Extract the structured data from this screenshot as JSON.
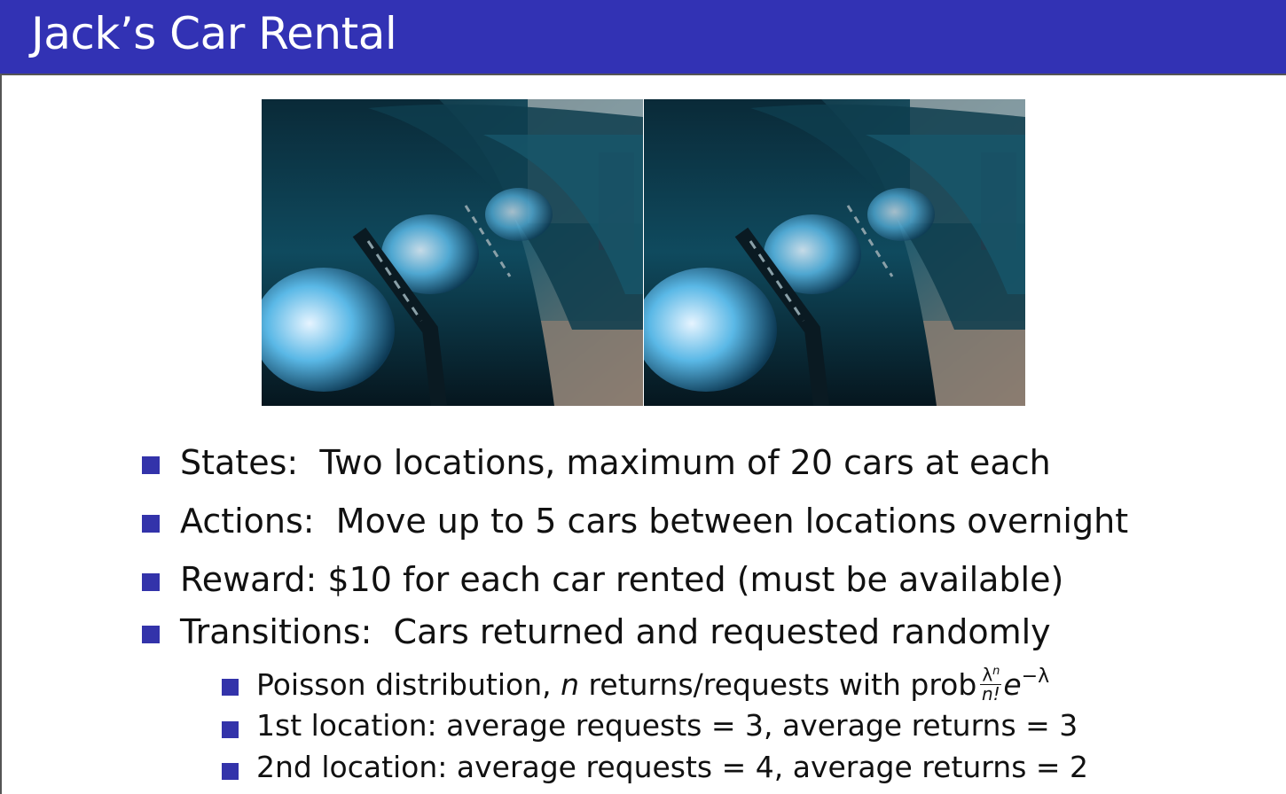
{
  "slide": {
    "title": "Jack’s Car Rental"
  },
  "images": [
    {
      "name": "cars-photo-left",
      "description": "row of parked cars"
    },
    {
      "name": "cars-photo-right",
      "description": "row of parked cars"
    }
  ],
  "bullets": [
    {
      "label": "States:",
      "text": "Two locations, maximum of 20 cars at each"
    },
    {
      "label": "Actions:",
      "text": "Move up to 5 cars between locations overnight"
    },
    {
      "label": "Reward:",
      "text": "$10 for each car rented (must be available)"
    },
    {
      "label": "Transitions:",
      "text": "Cars returned and requested randomly"
    }
  ],
  "sub_bullets": {
    "poisson": {
      "before": "Poisson distribution,",
      "var": "n",
      "after": "returns/requests with prob",
      "frac_num": "λ",
      "frac_num_sup": "n",
      "frac_den": "n!",
      "exp_base": "e",
      "exp_power": "−λ"
    },
    "loc1": "1st location: average requests = 3, average returns = 3",
    "loc2": "2nd location: average requests = 4, average returns = 2"
  },
  "colors": {
    "header": "#3232b4",
    "bullet": "#3333aa"
  }
}
